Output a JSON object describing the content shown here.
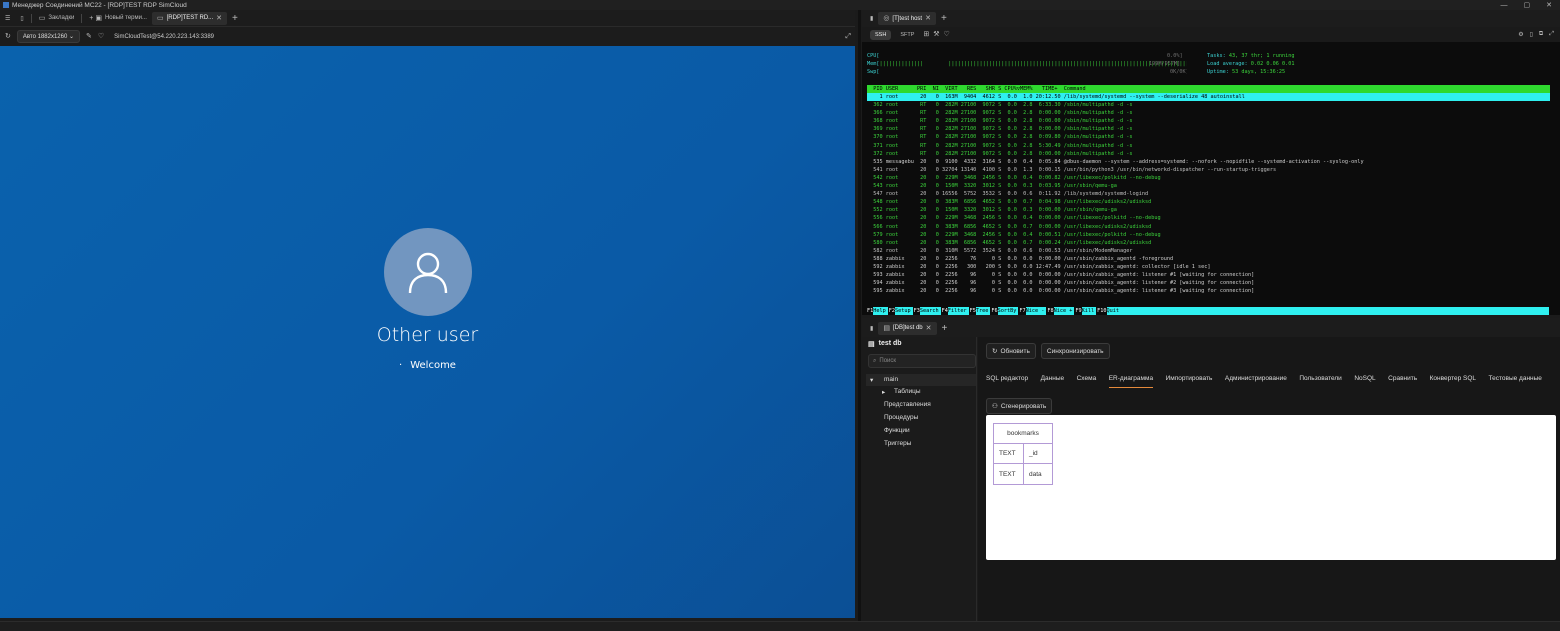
{
  "window": {
    "title": "Менеджер Соединений MC22 - [RDP]TEST RDP SimCloud",
    "controls": [
      "—",
      "▢",
      "✕"
    ]
  },
  "left": {
    "tabs": [
      "Закладки",
      "Новый терми...",
      "[RDP]TEST RD..."
    ],
    "resolution": "Авто 1882x1260",
    "address": "SimCloudTest@54.220.223.143:3389",
    "user": "Other user",
    "welcome": "Welcome"
  },
  "terminal": {
    "tab": "[T]test host",
    "modes": [
      "SSH",
      "SFTP"
    ],
    "meters": [
      {
        "label": "CPU[",
        "value": "0.0%]"
      },
      {
        "label": "Mem[",
        "value": "199M/957M]"
      },
      {
        "label": "Swp[",
        "value": "0K/0K]"
      }
    ],
    "stats": [
      {
        "k": "Tasks: ",
        "v": "43, 37 thr; 1 running"
      },
      {
        "k": "Load average: ",
        "v": "0.02 0.06 0.01"
      },
      {
        "k": "Uptime: ",
        "v": "53 days, 15:36:25"
      }
    ],
    "header": "  PID USER      PRI  NI  VIRT   RES   SHR S CPU%▽MEM%   TIME+  Command",
    "selected": "    1 root       20   0  163M  9404  4612 S  0.0  1.0 20:12.50 /lib/systemd/systemd --system --deserialize 48 autoinstall",
    "rows": [
      "  362 root       RT   0  282M 27100  9072 S  0.0  2.8  6:33.30 /sbin/multipathd -d -s",
      "  366 root       RT   0  282M 27100  9072 S  0.0  2.8  0:00.00 /sbin/multipathd -d -s",
      "  368 root       RT   0  282M 27100  9072 S  0.0  2.8  0:00.00 /sbin/multipathd -d -s",
      "  369 root       RT   0  282M 27100  9072 S  0.0  2.8  0:00.00 /sbin/multipathd -d -s",
      "  370 root       RT   0  282M 27100  9072 S  0.0  2.8  0:09.80 /sbin/multipathd -d -s",
      "  371 root       RT   0  282M 27100  9072 S  0.0  2.8  5:30.49 /sbin/multipathd -d -s",
      "  372 root       RT   0  282M 27100  9072 S  0.0  2.8  0:00.00 /sbin/multipathd -d -s",
      "  535 messagebu  20   0  9100  4332  3164 S  0.0  0.4  0:05.84 @dbus-daemon --system --address=systemd: --nofork --nopidfile --systemd-activation --syslog-only",
      "  541 root       20   0 32704 13140  4100 S  0.0  1.3  0:00.15 /usr/bin/python3 /usr/bin/networkd-dispatcher --run-startup-triggers",
      "  542 root       20   0  229M  3468  2456 S  0.0  0.4  0:00.82 /usr/libexec/polkitd --no-debug",
      "  543 root       20   0  150M  3320  3012 S  0.0  0.3  0:03.95 /usr/sbin/qemu-ga",
      "  547 root       20   0 16556  5752  3532 S  0.0  0.6  0:11.92 /lib/systemd/systemd-logind",
      "  548 root       20   0  383M  6856  4652 S  0.0  0.7  0:04.98 /usr/libexec/udisks2/udisksd",
      "  552 root       20   0  150M  3320  3012 S  0.0  0.3  0:00.00 /usr/sbin/qemu-ga",
      "  556 root       20   0  229M  3468  2456 S  0.0  0.4  0:00.00 /usr/libexec/polkitd --no-debug",
      "  566 root       20   0  383M  6856  4652 S  0.0  0.7  0:00.00 /usr/libexec/udisks2/udisksd",
      "  579 root       20   0  229M  3468  2456 S  0.0  0.4  0:00.51 /usr/libexec/polkitd --no-debug",
      "  580 root       20   0  383M  6856  4652 S  0.0  0.7  0:00.24 /usr/libexec/udisks2/udisksd",
      "  582 root       20   0  310M  5572  3524 S  0.0  0.6  0:00.53 /usr/sbin/ModemManager",
      "  588 zabbix     20   0  2256    76     0 S  0.0  0.0  0:00.00 /usr/sbin/zabbix_agentd -foreground",
      "  592 zabbix     20   0  2256   300   200 S  0.0  0.0 12:47.49 /usr/sbin/zabbix_agentd: collector [idle 1 sec]",
      "  593 zabbix     20   0  2256    96     0 S  0.0  0.0  0:00.00 /usr/sbin/zabbix_agentd: listener #1 [waiting for connection]",
      "  594 zabbix     20   0  2256    96     0 S  0.0  0.0  0:00.00 /usr/sbin/zabbix_agentd: listener #2 [waiting for connection]",
      "  595 zabbix     20   0  2256    96     0 S  0.0  0.0  0:00.00 /usr/sbin/zabbix_agentd: listener #3 [waiting for connection]"
    ],
    "fkeys": [
      [
        "F1",
        "Help"
      ],
      [
        "F2",
        "Setup"
      ],
      [
        "F3",
        "Search"
      ],
      [
        "F4",
        "Filter"
      ],
      [
        "F5",
        "Tree"
      ],
      [
        "F6",
        "SortBy"
      ],
      [
        "F7",
        "Nice -"
      ],
      [
        "F8",
        "Nice +"
      ],
      [
        "F9",
        "Kill"
      ],
      [
        "F10",
        "Quit"
      ]
    ]
  },
  "db": {
    "tab": "[DB]test db",
    "name": "test db",
    "search_placeholder": "Поиск",
    "tree": {
      "schema": "main",
      "tables": "Таблицы",
      "items": [
        "Представления",
        "Процедуры",
        "Функции",
        "Триггеры"
      ]
    },
    "buttons": {
      "refresh": "Обновить",
      "sync": "Синхронизировать",
      "generate": "Сгенерировать"
    },
    "nav": [
      "SQL редактор",
      "Данные",
      "Схема",
      "ER-диаграмма",
      "Импортировать",
      "Администрирование",
      "Пользователи",
      "NoSQL",
      "Сравнить",
      "Конвертер SQL",
      "Тестовые данные"
    ],
    "active_nav": "ER-диаграмма",
    "er": {
      "table": "bookmarks",
      "columns": [
        {
          "type": "TEXT",
          "name": "_id"
        },
        {
          "type": "TEXT",
          "name": "data"
        }
      ]
    }
  }
}
